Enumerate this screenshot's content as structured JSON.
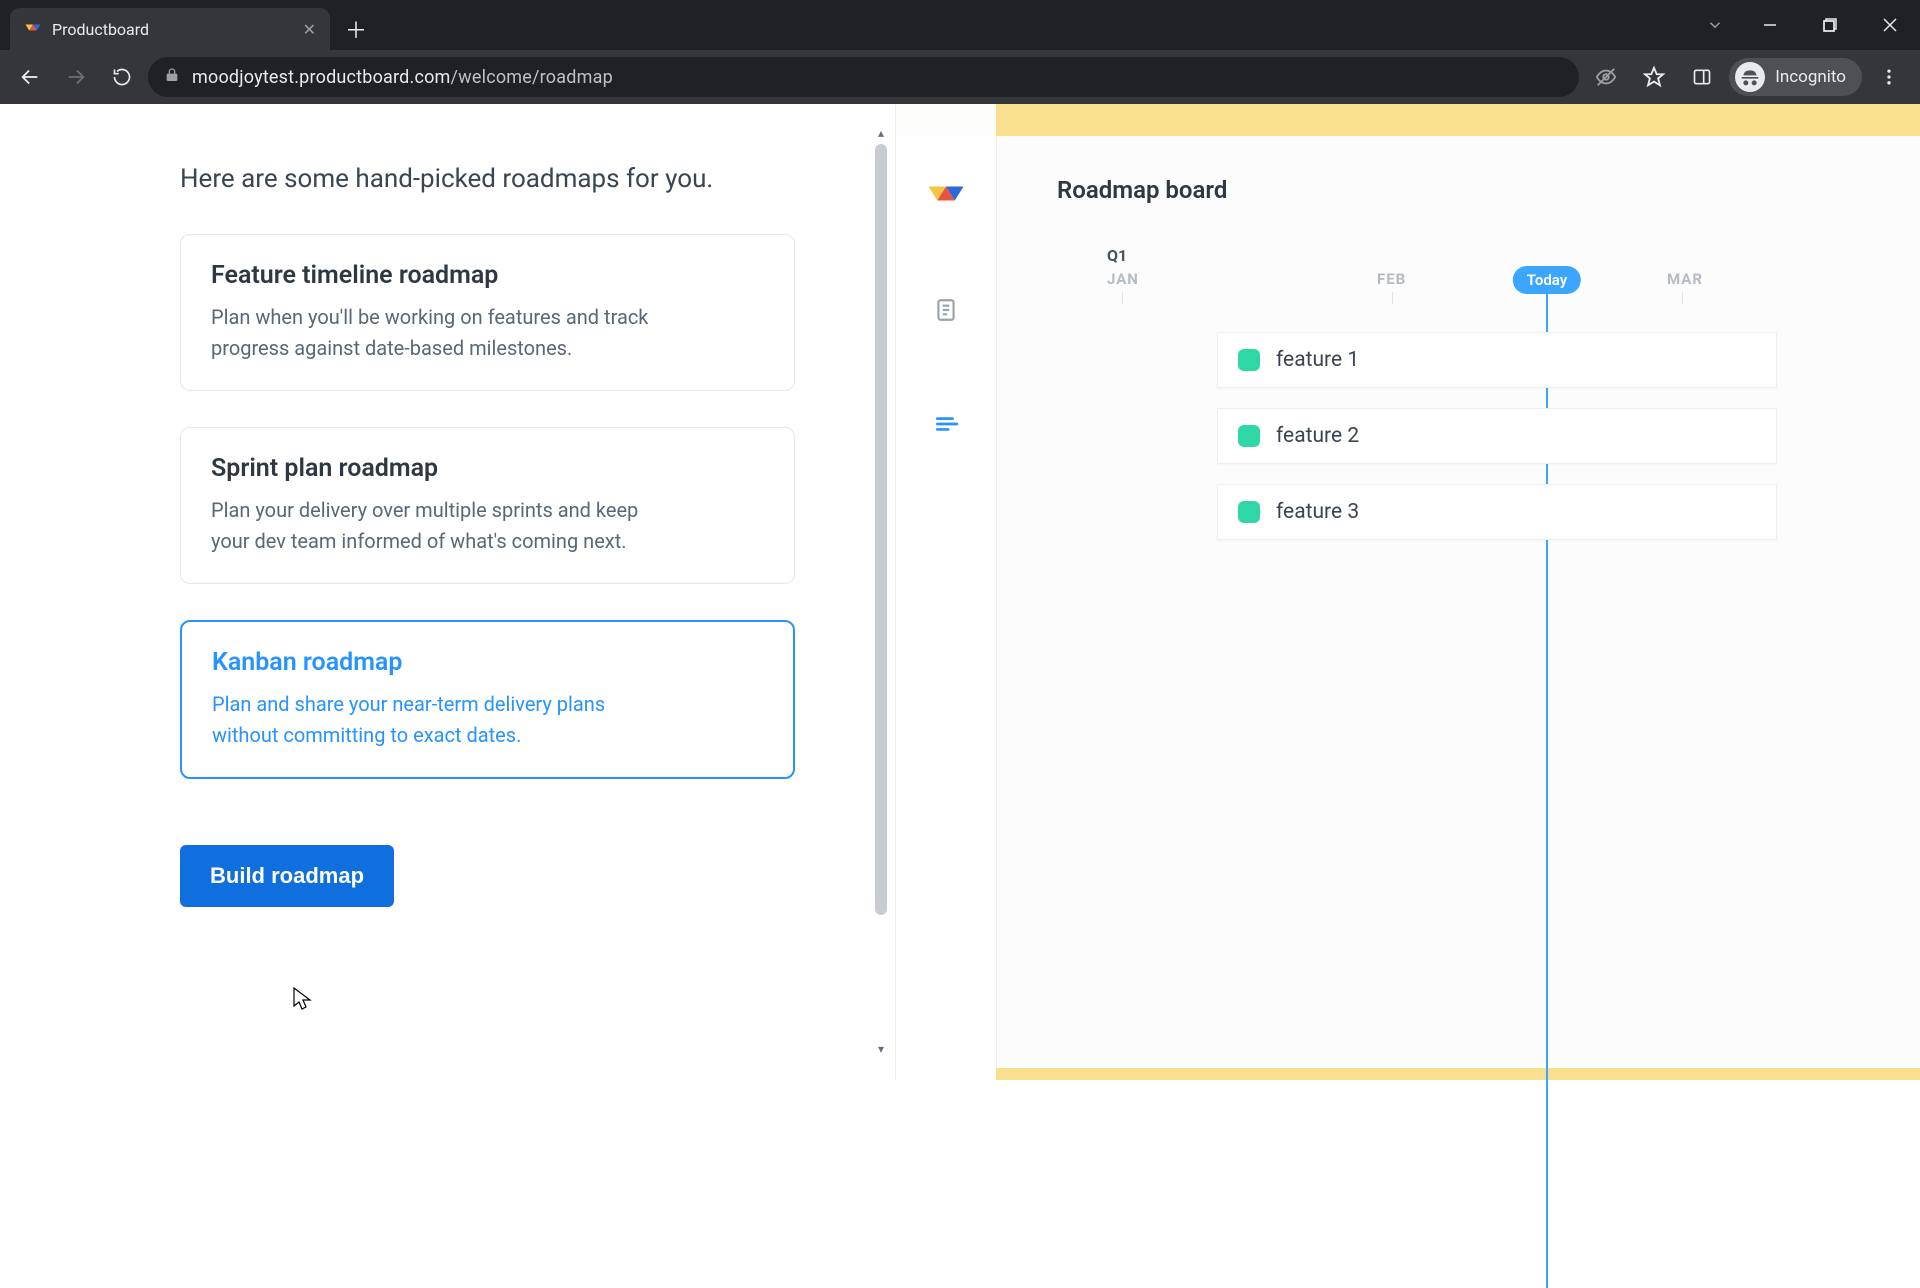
{
  "browser": {
    "tab_title": "Productboard",
    "url_host": "moodjoytest.productboard.com",
    "url_path": "/welcome/roadmap",
    "incognito_label": "Incognito"
  },
  "left": {
    "heading": "Here are some hand-picked roadmaps for you.",
    "options": [
      {
        "title": "Feature timeline roadmap",
        "desc": "Plan when you'll be working on features and track progress against date-based milestones.",
        "selected": false
      },
      {
        "title": "Sprint plan roadmap",
        "desc": "Plan your delivery over multiple sprints and keep your dev team informed of what's coming next.",
        "selected": false
      },
      {
        "title": "Kanban roadmap",
        "desc": "Plan and share your near-term delivery plans without committing to exact dates.",
        "selected": true
      }
    ],
    "build_label": "Build roadmap"
  },
  "preview": {
    "board_title": "Roadmap board",
    "quarter": "Q1",
    "months": [
      "JAN",
      "FEB",
      "MAR"
    ],
    "today_label": "Today",
    "features": [
      "feature 1",
      "feature 2",
      "feature 3"
    ],
    "accent_color": "#2fd7a6"
  }
}
